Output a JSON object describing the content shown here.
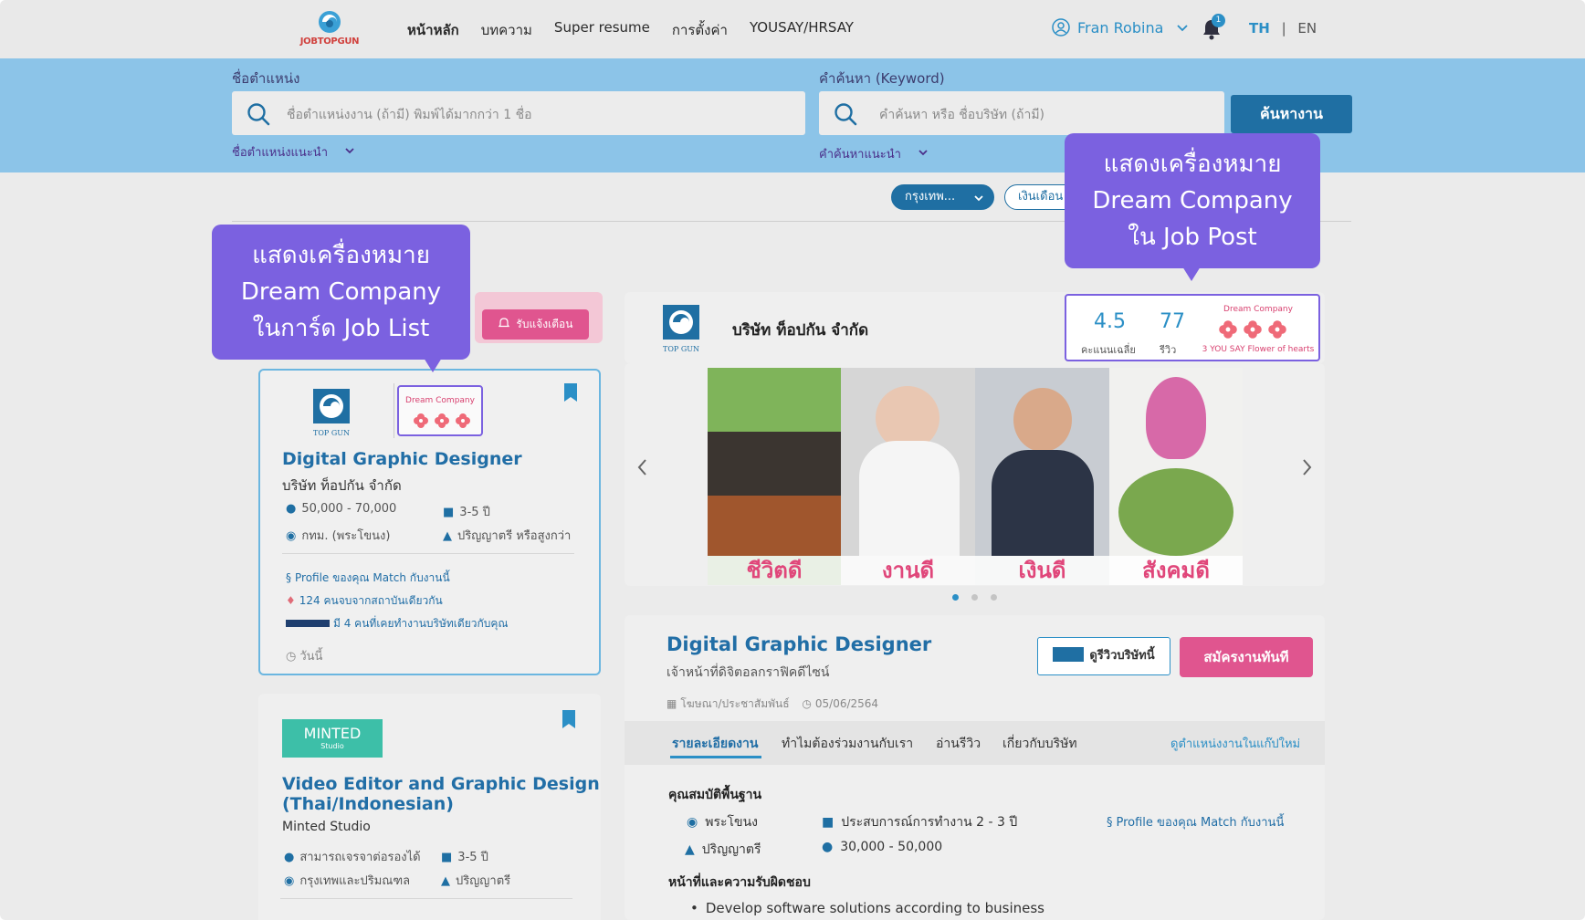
{
  "header": {
    "logo_text": "JOBTOPGUN",
    "nav": [
      "หน้าหลัก",
      "บทความ",
      "Super resume",
      "การตั้งค่า",
      "YOUSAY/HRSAY"
    ],
    "user_name": "Fran Robina",
    "notification_count": "1",
    "lang_th": "TH",
    "lang_sep": "|",
    "lang_en": "EN"
  },
  "search": {
    "position_label": "ชื่อตำแหน่ง",
    "position_placeholder": "ชื่อตำแหน่งงาน (ถ้ามี) พิมพ์ได้มากกว่า 1 ชื่อ",
    "keyword_label": "คำค้นหา (Keyword)",
    "keyword_placeholder": "คำค้นหา หรือ ชื่อบริษัท (ถ้ามี)",
    "search_button": "ค้นหางาน",
    "position_suggest": "ชื่อตำแหน่งแนะนำ",
    "keyword_suggest": "คำค้นหาแนะนำ"
  },
  "filters": {
    "location": "กรุงเทพ...",
    "salary": "เงินเดือน"
  },
  "callouts": {
    "job_list": [
      "แสดงเครื่องหมาย",
      "Dream Company",
      "ในการ์ด Job List"
    ],
    "job_post": [
      "แสดงเครื่องหมาย",
      "Dream Company",
      "ใน Job Post"
    ]
  },
  "alert_button": "รับแจ้งเตือน",
  "job_cards": [
    {
      "logo_text": "TOP GUN",
      "dream_label": "Dream Company",
      "title": "Digital Graphic Designer",
      "company": "บริษัท ท็อปกัน จำกัด",
      "salary": "50,000 - 70,000",
      "experience": "3-5 ปี",
      "location": "กทม. (พระโขนง)",
      "education": "ปริญญาตรี หรือสูงกว่า",
      "match": "Profile ของคุณ Match กับงานนี้",
      "alumni": "124 คนจบจากสถาบันเดียวกัน",
      "coworkers": "มี 4 คนที่เคยทำงานบริษัทเดียวกับคุณ",
      "posted": "วันนี้"
    },
    {
      "logo_text": "MINTED",
      "logo_sub": "Studio",
      "title_line1": "Video Editor and Graphic Design",
      "title_line2": "(Thai/Indonesian)",
      "company": "Minted Studio",
      "salary": "สามารถเจรจาต่อรองได้",
      "experience": "3-5 ปี",
      "location": "กรุงเทพและปริมณฑล",
      "education": "ปริญญาตรี"
    }
  ],
  "post": {
    "company": "บริษัท ท็อปกัน จำกัด",
    "logo_text": "TOP GUN",
    "rating": "4.5",
    "rating_label": "คะแนนเฉลี่ย",
    "reviews": "77",
    "reviews_label": "รีวิว",
    "dream_label": "Dream Company",
    "dream_sub": "3 YOU SAY Flower of hearts",
    "photos": [
      "ชีวิตดี",
      "งานดี",
      "เงินดี",
      "สังคมดี"
    ],
    "title": "Digital Graphic Designer",
    "subtitle": "เจ้าหน้าที่ดิจิตอลกราฟิคดีไซน์",
    "category": "โฆษณา/ประชาสัมพันธ์",
    "date": "05/06/2564",
    "review_button": "ดูรีวิวบริษัทนี้",
    "apply_button": "สมัครงานทันที",
    "tabs": [
      "รายละเอียดงาน",
      "ทำไมต้องร่วมงานกับเรา",
      "อ่านรีวิว",
      "เกี่ยวกับบริษัท"
    ],
    "history_link": "ดูตำแหน่งงานในแก๊ปใหม่",
    "basic_title": "คุณสมบัติพื้นฐาน",
    "basic_location": "พระโขนง",
    "basic_experience": "ประสบการณ์การทำงาน 2 - 3 ปี",
    "basic_education": "ปริญญาตรี",
    "basic_salary": "30,000 - 50,000",
    "match": "Profile ของคุณ Match กับงานนี้",
    "duties_title": "หน้าที่และความรับผิดชอบ",
    "duty_1": "Develop software solutions according to business"
  },
  "colors": {
    "accent": "#2b8fc6",
    "callout": "#7b61e0",
    "apply": "#e0558f",
    "search_band": "#8cc4e8"
  }
}
